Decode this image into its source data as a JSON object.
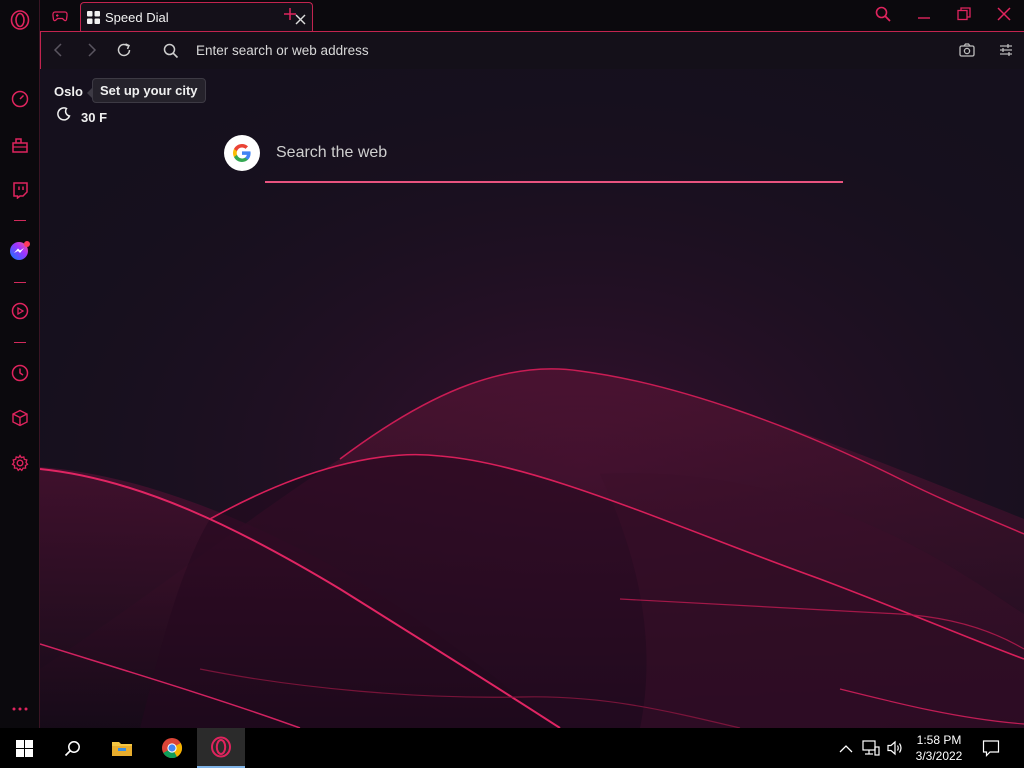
{
  "tab": {
    "title": "Speed Dial"
  },
  "address_bar": {
    "placeholder": "Enter search or web address"
  },
  "weather": {
    "city": "Oslo",
    "tooltip": "Set up your city",
    "temperature": "30 F"
  },
  "search": {
    "placeholder": "Search the web"
  },
  "sidebar": {
    "items": [
      "opera-menu-icon",
      "speedometer-icon",
      "workspace-bag-icon",
      "twitch-icon",
      "messenger-icon",
      "player-icon",
      "history-icon",
      "extensions-cube-icon",
      "settings-gear-icon",
      "more-icon"
    ]
  },
  "taskbar": {
    "time": "1:58 PM",
    "date": "3/3/2022"
  },
  "colors": {
    "accent": "#e0245e",
    "content_bg": "#15101d",
    "sidebar_bg": "#0b090d"
  }
}
